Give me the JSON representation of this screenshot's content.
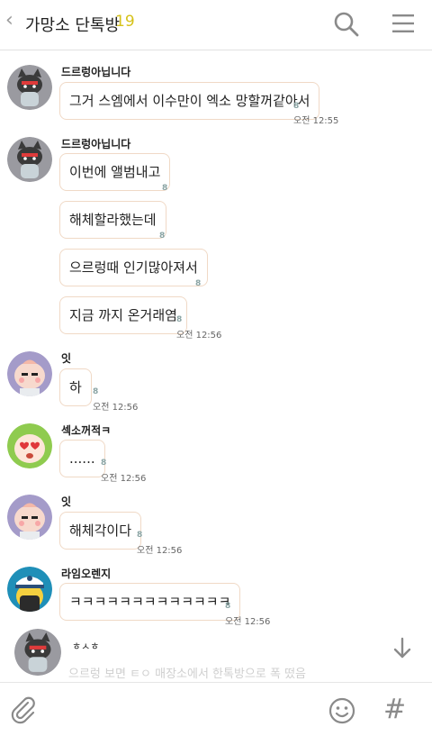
{
  "header": {
    "back": "‹",
    "title": "가망소 단톡방",
    "count": "19"
  },
  "messages": [
    {
      "sender": "드르렁아닙니다",
      "avatar": "cat-avatar",
      "bubbles": [
        {
          "text": "그거 스엠에서 이수만이 엑소 망할꺼같아서",
          "unread": "8",
          "time": "오전 12:55"
        }
      ]
    },
    {
      "sender": "드르렁아닙니다",
      "avatar": "cat-avatar",
      "bubbles": [
        {
          "text": "이번에 앨범내고",
          "unread": "8",
          "time": ""
        },
        {
          "text": "해체할라했는데",
          "unread": "8",
          "time": ""
        },
        {
          "text": "으르렁때 인기많아져서",
          "unread": "8",
          "time": ""
        },
        {
          "text": "지금 까지 온거래염",
          "unread": "8",
          "time": "오전 12:56"
        }
      ]
    },
    {
      "sender": "잇",
      "avatar": "peach-avatar",
      "bubbles": [
        {
          "text": "하",
          "unread": "8",
          "time": "오전 12:56"
        }
      ]
    },
    {
      "sender": "섹소꺼적ㅋ",
      "avatar": "heart-eyes-avatar",
      "bubbles": [
        {
          "text": "......",
          "unread": "8",
          "time": "오전 12:56"
        }
      ]
    },
    {
      "sender": "잇",
      "avatar": "peach-avatar",
      "bubbles": [
        {
          "text": "해체각이다",
          "unread": "8",
          "time": "오전 12:56"
        }
      ]
    },
    {
      "sender": "라임오렌지",
      "avatar": "blue-cap-avatar",
      "bubbles": [
        {
          "text": "ㅋㅋㅋㅋㅋㅋㅋㅋㅋㅋㅋㅋㅋ",
          "unread": "8",
          "time": "오전 12:56"
        }
      ]
    }
  ],
  "preview": {
    "name": "ㅎㅅㅎ",
    "text": "으르렁 보면 ㅌㅇ 매장소에서 한톡방으로 폭 떴음"
  },
  "colors": {
    "accent": "#d6c21a",
    "bubble_border": "#f0d9c6",
    "unread": "#8aa4a4"
  },
  "icons": {
    "search": "search-icon",
    "menu": "menu-icon",
    "attach": "paperclip-icon",
    "emoji": "emoji-icon",
    "hash": "#",
    "scroll_down": "down-arrow-icon"
  }
}
